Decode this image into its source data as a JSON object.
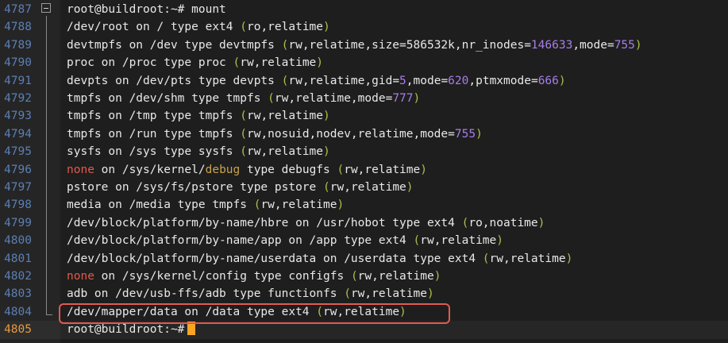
{
  "terminal": {
    "prompt": "root@buildroot:~#",
    "command": "mount",
    "lines": [
      {
        "num": "4787",
        "kind": "prompt"
      },
      {
        "num": "4788",
        "segments": [
          [
            "g",
            "/dev/root on / type ext4 "
          ],
          [
            "p",
            "("
          ],
          [
            "g",
            "ro,relatime"
          ],
          [
            "p",
            ")"
          ]
        ]
      },
      {
        "num": "4789",
        "segments": [
          [
            "g",
            "devtmpfs on /dev type devtmpfs "
          ],
          [
            "p",
            "("
          ],
          [
            "g",
            "rw,relatime,size"
          ],
          [
            "g",
            "="
          ],
          [
            "g",
            "586532k,nr_inodes"
          ],
          [
            "g",
            "="
          ],
          [
            "n",
            "146633"
          ],
          [
            "g",
            ",mode"
          ],
          [
            "g",
            "="
          ],
          [
            "n",
            "755"
          ],
          [
            "p",
            ")"
          ]
        ]
      },
      {
        "num": "4790",
        "segments": [
          [
            "g",
            "proc on /proc type proc "
          ],
          [
            "p",
            "("
          ],
          [
            "g",
            "rw,relatime"
          ],
          [
            "p",
            ")"
          ]
        ]
      },
      {
        "num": "4791",
        "segments": [
          [
            "g",
            "devpts on /dev/pts type devpts "
          ],
          [
            "p",
            "("
          ],
          [
            "g",
            "rw,relatime,gid"
          ],
          [
            "g",
            "="
          ],
          [
            "n",
            "5"
          ],
          [
            "g",
            ",mode"
          ],
          [
            "g",
            "="
          ],
          [
            "n",
            "620"
          ],
          [
            "g",
            ",ptmxmode"
          ],
          [
            "g",
            "="
          ],
          [
            "n",
            "666"
          ],
          [
            "p",
            ")"
          ]
        ]
      },
      {
        "num": "4792",
        "segments": [
          [
            "g",
            "tmpfs on /dev/shm type tmpfs "
          ],
          [
            "p",
            "("
          ],
          [
            "g",
            "rw,relatime,mode"
          ],
          [
            "g",
            "="
          ],
          [
            "n",
            "777"
          ],
          [
            "p",
            ")"
          ]
        ]
      },
      {
        "num": "4793",
        "segments": [
          [
            "g",
            "tmpfs on /tmp type tmpfs "
          ],
          [
            "p",
            "("
          ],
          [
            "g",
            "rw,relatime"
          ],
          [
            "p",
            ")"
          ]
        ]
      },
      {
        "num": "4794",
        "segments": [
          [
            "g",
            "tmpfs on /run type tmpfs "
          ],
          [
            "p",
            "("
          ],
          [
            "g",
            "rw,nosuid,nodev,relatime,mode"
          ],
          [
            "g",
            "="
          ],
          [
            "n",
            "755"
          ],
          [
            "p",
            ")"
          ]
        ]
      },
      {
        "num": "4795",
        "segments": [
          [
            "g",
            "sysfs on /sys type sysfs "
          ],
          [
            "p",
            "("
          ],
          [
            "g",
            "rw,relatime"
          ],
          [
            "p",
            ")"
          ]
        ]
      },
      {
        "num": "4796",
        "segments": [
          [
            "r",
            "none"
          ],
          [
            "g",
            " on /sys/kernel/"
          ],
          [
            "d",
            "debug"
          ],
          [
            "g",
            " type debugfs "
          ],
          [
            "p",
            "("
          ],
          [
            "g",
            "rw,relatime"
          ],
          [
            "p",
            ")"
          ]
        ]
      },
      {
        "num": "4797",
        "segments": [
          [
            "g",
            "pstore on /sys/fs/pstore type pstore "
          ],
          [
            "p",
            "("
          ],
          [
            "g",
            "rw,relatime"
          ],
          [
            "p",
            ")"
          ]
        ]
      },
      {
        "num": "4798",
        "segments": [
          [
            "g",
            "media on /media type tmpfs "
          ],
          [
            "p",
            "("
          ],
          [
            "g",
            "rw,relatime"
          ],
          [
            "p",
            ")"
          ]
        ]
      },
      {
        "num": "4799",
        "segments": [
          [
            "g",
            "/dev/block/platform/by-name/hbre on /usr/hobot type ext4 "
          ],
          [
            "p",
            "("
          ],
          [
            "g",
            "ro,noatime"
          ],
          [
            "p",
            ")"
          ]
        ]
      },
      {
        "num": "4800",
        "segments": [
          [
            "g",
            "/dev/block/platform/by-name/app on /app type ext4 "
          ],
          [
            "p",
            "("
          ],
          [
            "g",
            "rw,relatime"
          ],
          [
            "p",
            ")"
          ]
        ]
      },
      {
        "num": "4801",
        "segments": [
          [
            "g",
            "/dev/block/platform/by-name/userdata on /userdata type ext4 "
          ],
          [
            "p",
            "("
          ],
          [
            "g",
            "rw,relatime"
          ],
          [
            "p",
            ")"
          ]
        ]
      },
      {
        "num": "4802",
        "segments": [
          [
            "r",
            "none"
          ],
          [
            "g",
            " on /sys/kernel/config type configfs "
          ],
          [
            "p",
            "("
          ],
          [
            "g",
            "rw,relatime"
          ],
          [
            "p",
            ")"
          ]
        ]
      },
      {
        "num": "4803",
        "segments": [
          [
            "g",
            "adb on /dev/usb-ffs/adb type functionfs "
          ],
          [
            "p",
            "("
          ],
          [
            "g",
            "rw,relatime"
          ],
          [
            "p",
            ")"
          ]
        ]
      },
      {
        "num": "4804",
        "segments": [
          [
            "g",
            "/dev/mapper/data on /data type ext4 "
          ],
          [
            "p",
            "("
          ],
          [
            "g",
            "rw,relatime"
          ],
          [
            "p",
            ")"
          ]
        ]
      },
      {
        "num": "4805",
        "kind": "prompt-empty"
      }
    ]
  },
  "colors": {
    "background": "#1e1e1e",
    "gutter": "#252526",
    "line_number": "#5b7fb3",
    "current_line_number": "#e79a3c",
    "text": "#e8e8e8",
    "paren": "#a9c04d",
    "number": "#a77de8",
    "none_keyword": "#e05a4a",
    "debug_keyword": "#c9a24a",
    "highlight_box": "#e25a4f",
    "cursor": "#f5a623"
  },
  "icons": {
    "fold": "fold-collapse-icon"
  }
}
